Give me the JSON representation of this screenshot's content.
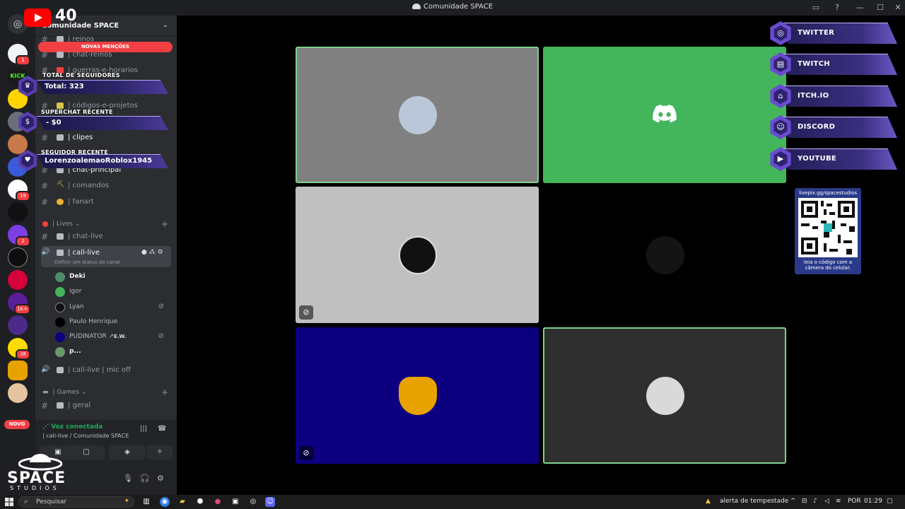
{
  "window": {
    "title": "Comunidade SPACE"
  },
  "overlay_youtube": {
    "count": "40"
  },
  "guild": {
    "name": "Comunidade SPACE",
    "new_mentions": "NOVAS MENÇÕES",
    "channels_top": [
      {
        "label": "| reinos"
      },
      {
        "label": "| chat-reinos"
      },
      {
        "label": "| guerras-e-horarios"
      },
      {
        "label": "| códigos-e-projetos"
      },
      {
        "label": "| clipes"
      },
      {
        "label": "| chat-principal"
      },
      {
        "label": "| comandos"
      },
      {
        "label": "| fanart"
      }
    ],
    "category_lives": "| Lives",
    "channel_chat_live": "| chat-live",
    "channel_call_live": "| call-live",
    "call_status": "Definir um status do canal",
    "voice_users": [
      {
        "name": "Deki"
      },
      {
        "name": "igor"
      },
      {
        "name": "Lyan"
      },
      {
        "name": "Paulo Henrique"
      },
      {
        "name": "PUDINATOR",
        "tag": "E.W."
      },
      {
        "name": "p..."
      }
    ],
    "channel_call_mic_off": "| call-live  |  mic off",
    "category_games": "| Games",
    "channel_geral": "| geral"
  },
  "voice_panel": {
    "status": "Voz conectada",
    "location": "| call-live / Comunidade SPACE"
  },
  "stream_overlay": {
    "followers_label": "TOTAL DE SEGUIDORES",
    "followers_value": "Total: 323",
    "superchat_label": "SUPERCHAT RECENTE",
    "superchat_value": "- $0",
    "follower_label": "SEGUIDOR RECENTE",
    "follower_value": "LorenzoalemaoRoblox1945"
  },
  "socials": [
    {
      "name": "TWITTER",
      "icon": "instagram-icon"
    },
    {
      "name": "TWITCH",
      "icon": "twitch-icon"
    },
    {
      "name": "ITCH.IO",
      "icon": "itchio-icon"
    },
    {
      "name": "DISCORD",
      "icon": "discord-icon"
    },
    {
      "name": "YOUTUBE",
      "icon": "youtube-icon"
    }
  ],
  "qr": {
    "top_text": "livepix.gg/spacestudios",
    "bottom_line1": "leia o código com a",
    "bottom_line2": "câmera do celular."
  },
  "logo": {
    "line1": "SPACE",
    "line2": "STUDIOS"
  },
  "rail_badges": [
    "1",
    "19",
    "2",
    "1K+",
    "38"
  ],
  "rail_novo": "NOVO",
  "tiles": [
    {
      "bg": "#808080",
      "speaking": true
    },
    {
      "bg": "#43b55b",
      "speaking": false
    },
    {
      "bg": "#c0c0c0",
      "speaking": false
    },
    {
      "bg": "#000000",
      "speaking": false
    },
    {
      "bg": "#0d0080",
      "speaking": false
    },
    {
      "bg": "#2f2f2f",
      "speaking": true
    }
  ],
  "taskbar": {
    "search_placeholder": "Pesquisar",
    "weather": "alerta de tempestade",
    "lang": "POR",
    "time": "01:29"
  }
}
